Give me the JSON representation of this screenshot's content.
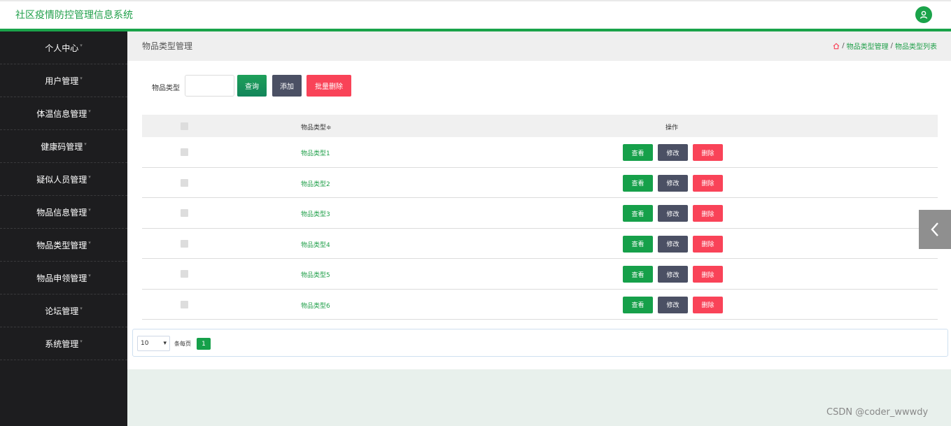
{
  "app": {
    "title": "社区疫情防控管理信息系统",
    "user_icon": "user-icon"
  },
  "sidebar": {
    "items": [
      {
        "label": "个人中心"
      },
      {
        "label": "用户管理"
      },
      {
        "label": "体温信息管理"
      },
      {
        "label": "健康码管理"
      },
      {
        "label": "疑似人员管理"
      },
      {
        "label": "物品信息管理"
      },
      {
        "label": "物品类型管理"
      },
      {
        "label": "物品申领管理"
      },
      {
        "label": "论坛管理"
      },
      {
        "label": "系统管理"
      }
    ]
  },
  "page": {
    "title": "物品类型管理",
    "breadcrumb": {
      "home_icon": "home-icon",
      "level1": "物品类型管理",
      "separator": "/",
      "level2": "物品类型列表"
    }
  },
  "search": {
    "label": "物品类型",
    "value": "",
    "query_label": "查询",
    "add_label": "添加",
    "bulk_delete_label": "批量删除"
  },
  "table": {
    "headers": {
      "type": "物品类型",
      "sort_icon": "≑",
      "ops": "操作"
    },
    "rows": [
      {
        "type": "物品类型1"
      },
      {
        "type": "物品类型2"
      },
      {
        "type": "物品类型3"
      },
      {
        "type": "物品类型4"
      },
      {
        "type": "物品类型5"
      },
      {
        "type": "物品类型6"
      }
    ],
    "actions": {
      "view": "查看",
      "edit": "修改",
      "delete": "删除"
    }
  },
  "pagination": {
    "page_size": "10",
    "page_size_label": "条每页",
    "current_page": "1"
  },
  "colors": {
    "accent": "#1aa34a",
    "danger": "#f94358",
    "dark": "#4b5064",
    "sidebar": "#1d1d1f"
  },
  "watermark": "CSDN @coder_wwwdy"
}
